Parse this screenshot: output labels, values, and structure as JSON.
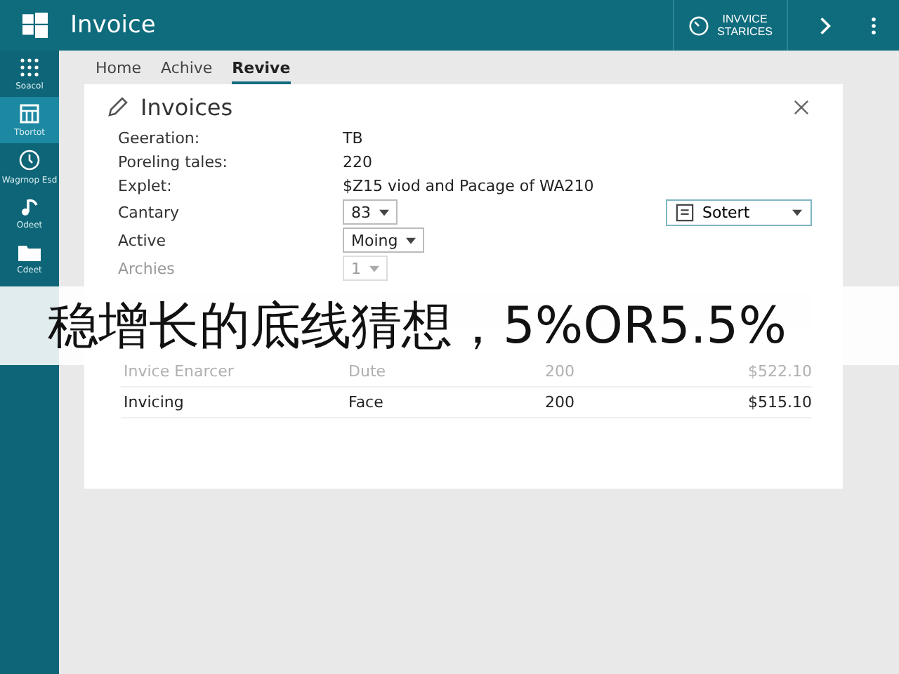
{
  "window": {
    "title": "Invoice"
  },
  "header_actions": {
    "status_lines": [
      "INVVICE",
      "STARICES"
    ]
  },
  "sidebar": {
    "items": [
      {
        "label": "Soacol",
        "selected": false
      },
      {
        "label": "Tbortot",
        "selected": true
      },
      {
        "label": "Wagrnop Esd",
        "selected": false
      },
      {
        "label": "Odeet",
        "selected": false
      },
      {
        "label": "Cdeet",
        "selected": false
      }
    ]
  },
  "tabs": [
    {
      "label": "Home",
      "selected": false
    },
    {
      "label": "Achive",
      "selected": false
    },
    {
      "label": "Revive",
      "selected": true
    }
  ],
  "dialog": {
    "title": "Invoices",
    "details": [
      {
        "label": "Geeration:",
        "value": "TB"
      },
      {
        "label": "Poreling tales:",
        "value": "220"
      },
      {
        "label": "Explet:",
        "value": "$Z15 viod and Pacage of WA210"
      }
    ],
    "selects": [
      {
        "label": "Cantary",
        "value": "83",
        "disabled": false
      },
      {
        "label": "Active",
        "value": "Moing",
        "disabled": false
      },
      {
        "label": "Archies",
        "value": "1",
        "disabled": true
      }
    ],
    "sort_select": {
      "value": "Sotert"
    },
    "table": {
      "rows": [
        {
          "cells": [
            "Invice Enarcer",
            "Dute",
            "200",
            "$522.10"
          ],
          "muted": true
        },
        {
          "cells": [
            "Invicing",
            "Face",
            "200",
            "$515.10"
          ],
          "muted": false
        }
      ]
    }
  },
  "caption": "稳增长的底线猜想，5%OR5.5%"
}
